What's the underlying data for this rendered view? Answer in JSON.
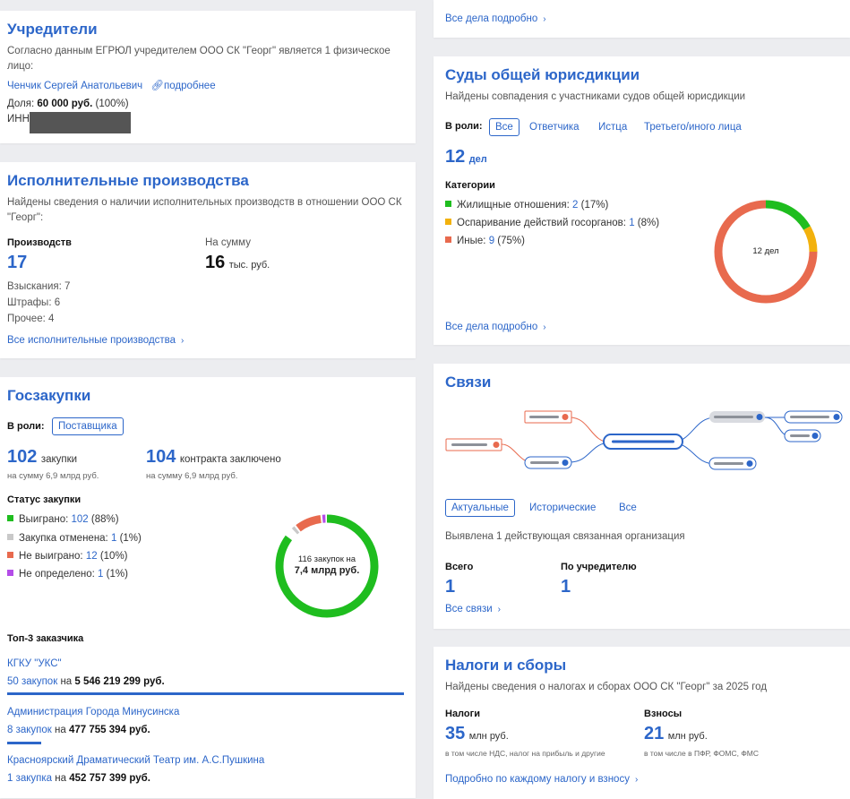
{
  "colors": {
    "accent": "#2c66c9",
    "green": "#1fbd1f",
    "red": "#e86a4e",
    "orange": "#f2b10d",
    "gray": "#c9c9c9",
    "purple": "#b44de8"
  },
  "founders": {
    "title": "Учредители",
    "desc": "Согласно данным ЕГРЮЛ учредителем ООО СК \"Георг\" является 1 физическое лицо:",
    "person": "Ченчик Сергей Анатольевич",
    "more": "подробнее",
    "share_label": "Доля:",
    "share_value": "60 000 руб.",
    "share_pct": "(100%)",
    "inn_label": "ИНН"
  },
  "enforcement": {
    "title": "Исполнительные производства",
    "desc": "Найдены сведения о наличии исполнительных производств в отношении ООО СК \"Георг\":",
    "count_label": "Производств",
    "count_value": "17",
    "sum_label": "На сумму",
    "sum_value": "16",
    "sum_unit": "тыс. руб.",
    "items": [
      "Взыскания: 7",
      "Штрафы: 6",
      "Прочее: 4"
    ],
    "all_link": "Все исполнительные производства"
  },
  "procurement": {
    "title": "Госзакупки",
    "role_label": "В роли:",
    "role_chip": "Поставщика",
    "purchases_num": "102",
    "purchases_label": "закупки",
    "purchases_sub": "на сумму 6,9 млрд руб.",
    "contracts_num": "104",
    "contracts_label": "контракта заключено",
    "contracts_sub": "на сумму 6,9 млрд руб.",
    "status_title": "Статус закупки",
    "statuses": [
      {
        "label": "Выиграно:",
        "count": "102",
        "pct": "(88%)"
      },
      {
        "label": "Закупка отменена:",
        "count": "1",
        "pct": "(1%)"
      },
      {
        "label": "Не выиграно:",
        "count": "12",
        "pct": "(10%)"
      },
      {
        "label": "Не определено:",
        "count": "1",
        "pct": "(1%)"
      }
    ],
    "donut_line1": "116 закупок на",
    "donut_line2": "7,4 млрд руб.",
    "top_title": "Топ-3 заказчика",
    "top": [
      {
        "name": "КГКУ \"УКС\"",
        "count": "50 закупок",
        "on": "на",
        "sum": "5 546 219 299 руб."
      },
      {
        "name": "Администрация Города Минусинска",
        "count": "8 закупок",
        "on": "на",
        "sum": "477 755 394 руб."
      },
      {
        "name": "Красноярский Драматический Театр им. А.С.Пушкина",
        "count": "1 закупка",
        "on": "на",
        "sum": "452 757 399 руб."
      }
    ]
  },
  "top_link": {
    "label": "Все дела подробно"
  },
  "courts": {
    "title": "Суды общей юрисдикции",
    "desc": "Найдены совпадения с участниками судов общей юрисдикции",
    "role_label": "В роли:",
    "roles": [
      "Все",
      "Ответчика",
      "Истца",
      "Третьего/иного лица"
    ],
    "count_value": "12",
    "count_unit": "дел",
    "cat_title": "Категории",
    "categories": [
      {
        "label": "Жилищные отношения:",
        "count": "2",
        "pct": "(17%)"
      },
      {
        "label": "Оспаривание действий госорганов:",
        "count": "1",
        "pct": "(8%)"
      },
      {
        "label": "Иные:",
        "count": "9",
        "pct": "(75%)"
      }
    ],
    "donut_label": "12 дел",
    "all_link": "Все дела подробно"
  },
  "links": {
    "title": "Связи",
    "tabs": [
      "Актуальные",
      "Исторические",
      "Все"
    ],
    "desc": "Выявлена 1 действующая связанная организация",
    "total_label": "Всего",
    "total_value": "1",
    "founder_label": "По учредителю",
    "founder_value": "1",
    "all_link": "Все связи"
  },
  "taxes": {
    "title": "Налоги и сборы",
    "desc": "Найдены сведения о налогах и сборах ООО СК \"Георг\" за 2025 год",
    "taxes_label": "Налоги",
    "taxes_value": "35",
    "taxes_unit": "млн руб.",
    "taxes_sub": "в том числе НДС, налог на прибыль и другие",
    "fees_label": "Взносы",
    "fees_value": "21",
    "fees_unit": "млн руб.",
    "fees_sub": "в том числе в ПФР, ФОМС, ФМС",
    "link": "Подробно по каждому налогу и взносу"
  }
}
